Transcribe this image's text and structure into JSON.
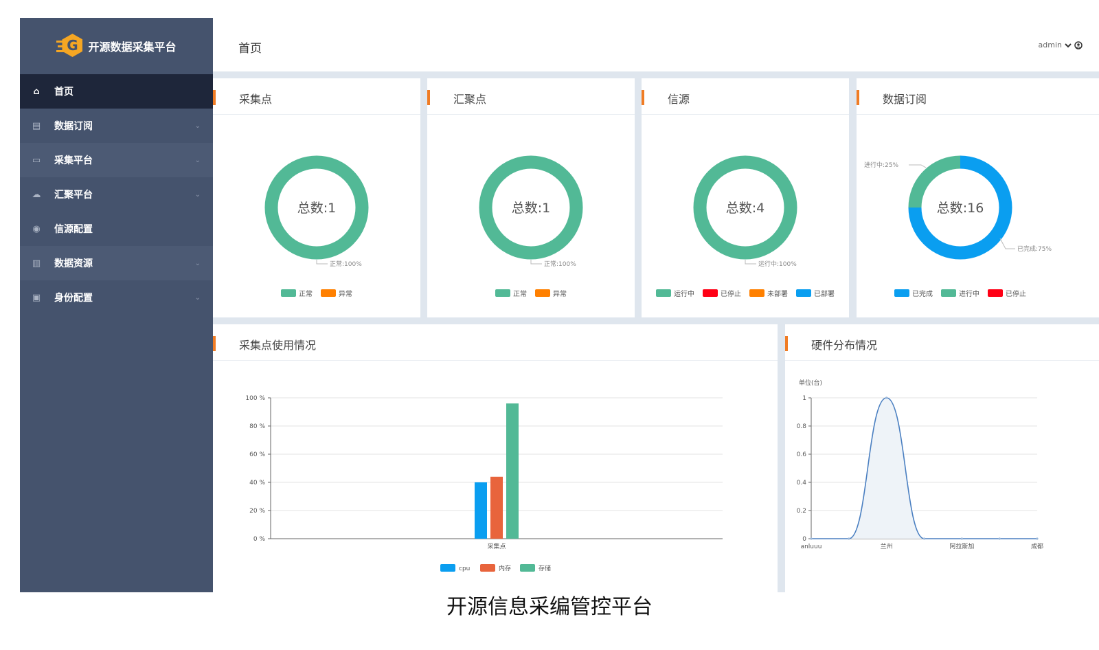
{
  "sidebar": {
    "brand": "开源数据采集平台",
    "logo_letter": "G",
    "items": [
      {
        "label": "首页",
        "icon": "home-icon",
        "glyph": "⌂",
        "expandable": false
      },
      {
        "label": "数据订阅",
        "icon": "subscription-icon",
        "glyph": "▤",
        "expandable": true
      },
      {
        "label": "采集平台",
        "icon": "monitor-icon",
        "glyph": "▭",
        "expandable": true
      },
      {
        "label": "汇聚平台",
        "icon": "cloud-icon",
        "glyph": "☁",
        "expandable": true
      },
      {
        "label": "信源配置",
        "icon": "location-icon",
        "glyph": "◉",
        "expandable": false
      },
      {
        "label": "数据资源",
        "icon": "database-icon",
        "glyph": "▥",
        "expandable": true
      },
      {
        "label": "身份配置",
        "icon": "id-card-icon",
        "glyph": "▣",
        "expandable": true
      }
    ]
  },
  "header": {
    "title": "首页",
    "user": "admin"
  },
  "cards": [
    {
      "title": "采集点",
      "total_label": "总数:1",
      "callout": "正常:100%",
      "legend": [
        {
          "name": "正常",
          "color": "#52b996"
        },
        {
          "name": "异常",
          "color": "#ff8000"
        }
      ]
    },
    {
      "title": "汇聚点",
      "total_label": "总数:1",
      "callout": "正常:100%",
      "legend": [
        {
          "name": "正常",
          "color": "#52b996"
        },
        {
          "name": "异常",
          "color": "#ff8000"
        }
      ]
    },
    {
      "title": "信源",
      "total_label": "总数:4",
      "callout": "运行中:100%",
      "legend": [
        {
          "name": "运行中",
          "color": "#52b996"
        },
        {
          "name": "已停止",
          "color": "#ff0015"
        },
        {
          "name": "未部署",
          "color": "#ff8000"
        },
        {
          "name": "已部署",
          "color": "#0a9ef0"
        }
      ]
    },
    {
      "title": "数据订阅",
      "total_label": "总数:16",
      "callout_a": "进行中:25%",
      "callout_b": "已完成:75%",
      "legend": [
        {
          "name": "已完成",
          "color": "#0a9ef0"
        },
        {
          "name": "进行中",
          "color": "#52b996"
        },
        {
          "name": "已停止",
          "color": "#ff0015"
        }
      ]
    }
  ],
  "chart_data": [
    {
      "type": "pie",
      "title": "采集点",
      "labels": [
        "正常"
      ],
      "values": [
        100
      ],
      "colors": [
        "#52b996"
      ]
    },
    {
      "type": "pie",
      "title": "汇聚点",
      "labels": [
        "正常"
      ],
      "values": [
        100
      ],
      "colors": [
        "#52b996"
      ]
    },
    {
      "type": "pie",
      "title": "信源",
      "labels": [
        "运行中"
      ],
      "values": [
        100
      ],
      "colors": [
        "#52b996"
      ]
    },
    {
      "type": "pie",
      "title": "数据订阅",
      "labels": [
        "已完成",
        "进行中"
      ],
      "values": [
        75,
        25
      ],
      "colors": [
        "#0a9ef0",
        "#52b996"
      ]
    },
    {
      "type": "bar",
      "title": "采集点使用情况",
      "categories": [
        "采集点"
      ],
      "series": [
        {
          "name": "cpu",
          "values": [
            40
          ],
          "color": "#0a9ef0"
        },
        {
          "name": "内存",
          "values": [
            44
          ],
          "color": "#e8643c"
        },
        {
          "name": "存储",
          "values": [
            96
          ],
          "color": "#52b996"
        }
      ],
      "ylim": [
        0,
        100
      ],
      "yticks": [
        "0 %",
        "20 %",
        "40 %",
        "60 %",
        "80 %",
        "100 %"
      ]
    },
    {
      "type": "area",
      "title": "硬件分布情况",
      "ylabel": "单位(台)",
      "x": [
        "anluuu",
        "",
        "兰州",
        "",
        "阿拉斯加",
        "",
        "成都"
      ],
      "values": [
        0,
        0,
        1,
        0,
        0,
        0,
        0
      ],
      "ylim": [
        0,
        1
      ],
      "yticks": [
        "0",
        "0.2",
        "0.4",
        "0.6",
        "0.8",
        "1"
      ],
      "color": "#4a7fc1"
    }
  ],
  "bar_panel": {
    "title": "采集点使用情况"
  },
  "line_panel": {
    "title": "硬件分布情况"
  },
  "caption": "开源信息采编管控平台"
}
